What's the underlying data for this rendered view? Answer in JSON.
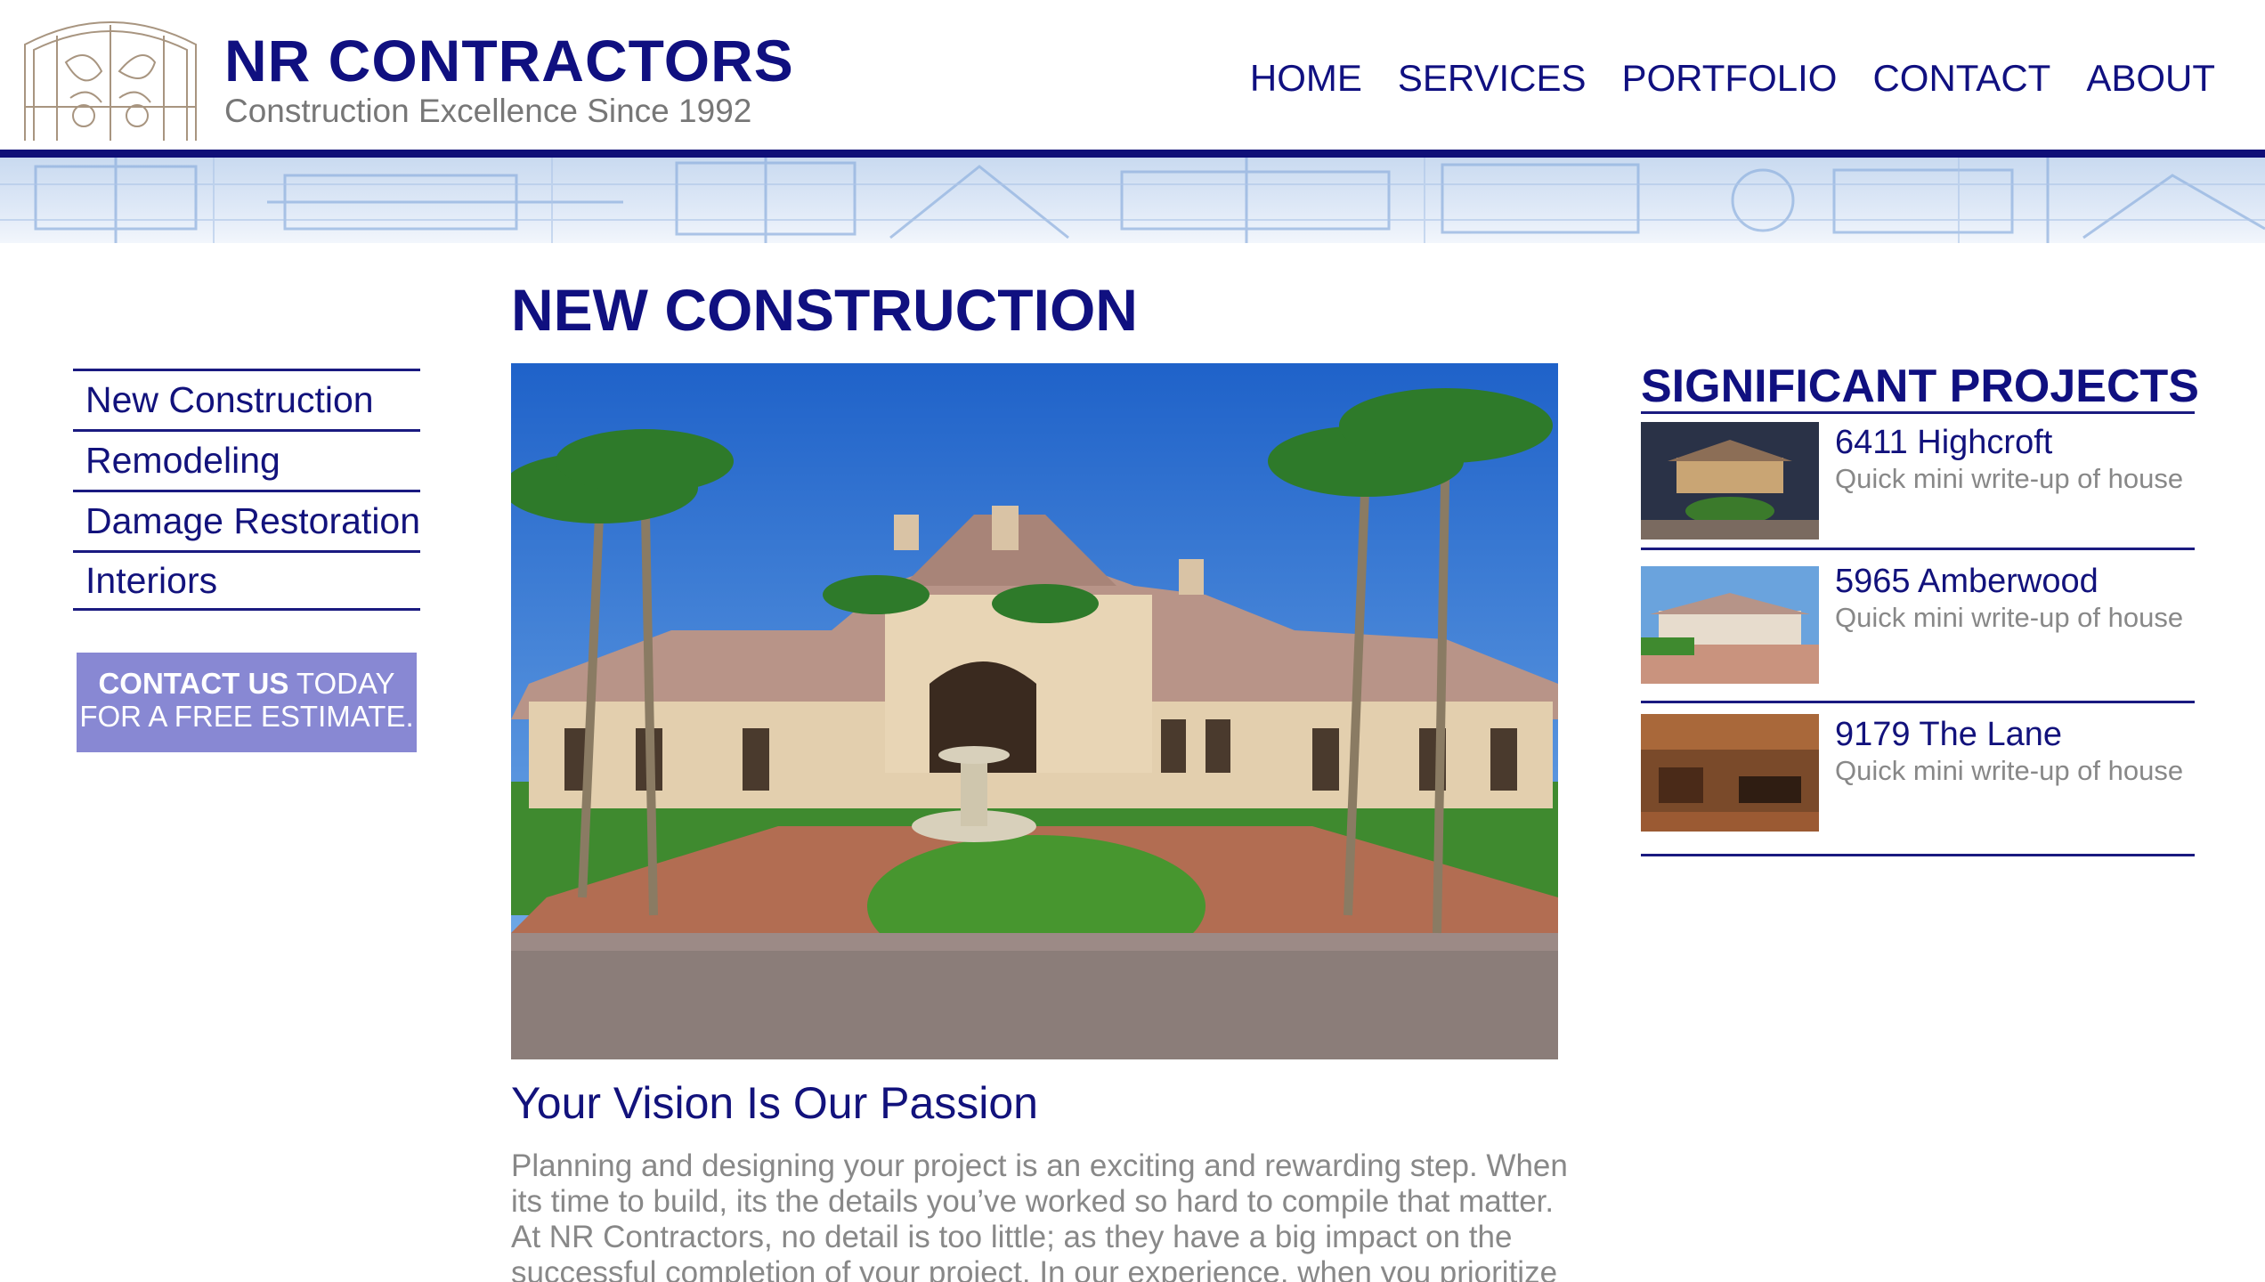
{
  "brand": {
    "title": "NR CONTRACTORS",
    "tagline": "Construction Excellence Since 1992"
  },
  "nav": {
    "items": [
      "HOME",
      "SERVICES",
      "PORTFOLIO",
      "CONTACT",
      "ABOUT"
    ]
  },
  "sidebar": {
    "items": [
      "New Construction",
      "Remodeling",
      "Damage Restoration",
      "Interiors"
    ],
    "cta": {
      "bold": "CONTACT US",
      "rest1": " TODAY",
      "line2": "FOR A FREE ESTIMATE."
    }
  },
  "main": {
    "title": "NEW CONSTRUCTION",
    "subtitle": "Your Vision Is Our Passion",
    "body": "Planning and designing your project is an exciting and rewarding step. When its time to build, its the details you’ve worked so hard to compile that matter. At NR Contractors, no detail is too little; as they have a big impact on the successful completion of your project. In our experience, when you prioritize"
  },
  "projects": {
    "title": "SIGNIFICANT PROJECTS",
    "items": [
      {
        "name": "6411 Highcroft",
        "desc": "Quick mini write-up of house"
      },
      {
        "name": "5965 Amberwood",
        "desc": "Quick mini write-up of house"
      },
      {
        "name": "9179 The Lane",
        "desc": "Quick mini write-up of house"
      }
    ]
  },
  "colors": {
    "brand_navy": "#101080",
    "cta_bg": "#8888d3",
    "muted_text": "#888888"
  },
  "icons": [
    "logo-gate-icon"
  ]
}
